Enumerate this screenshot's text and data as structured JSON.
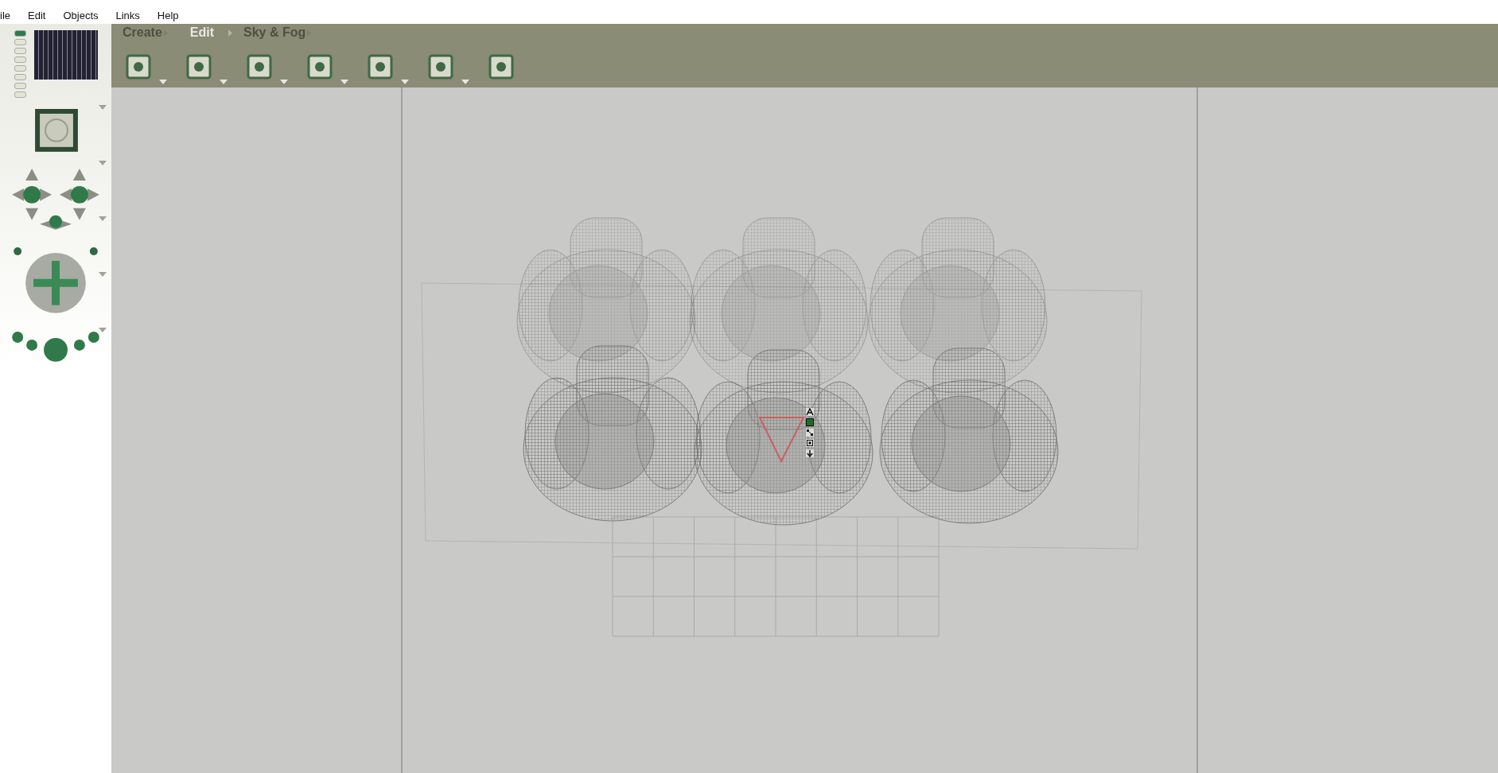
{
  "menu": [
    {
      "label": "ile"
    },
    {
      "label": "Edit"
    },
    {
      "label": "Objects"
    },
    {
      "label": "Links"
    },
    {
      "label": "Help"
    }
  ],
  "palette_tabs": [
    {
      "label": "Create",
      "selected": false
    },
    {
      "label": "Edit",
      "selected": true
    },
    {
      "label": "Sky & Fog",
      "selected": false
    }
  ]
}
